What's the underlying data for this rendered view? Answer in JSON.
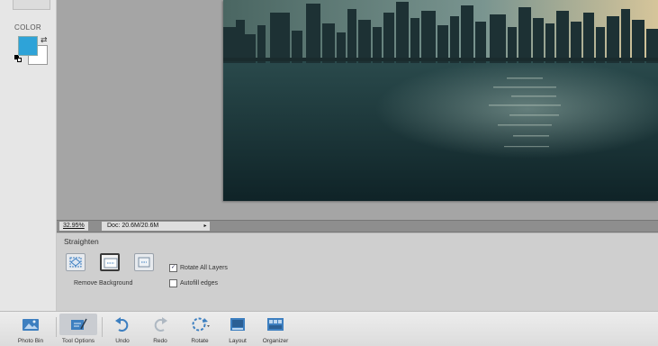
{
  "toolbox": {
    "color_label": "COLOR",
    "foreground_color": "#2ea3d8",
    "background_color": "#ffffff"
  },
  "status": {
    "zoom": "32.95%",
    "doc_size": "Doc: 20.6M/20.6M",
    "arrow": "▸"
  },
  "tool_options": {
    "title": "Straighten",
    "modes": [
      {
        "icon": "crop-to-original-size-icon",
        "selected": false
      },
      {
        "icon": "remove-background-icon",
        "selected": true
      },
      {
        "icon": "crop-to-remove-background-icon",
        "selected": false
      }
    ],
    "mode_caption": "Remove Background",
    "rotate_all_layers": {
      "label": "Rotate All Layers",
      "checked": true
    },
    "autofill_edges": {
      "label": "Autofill edges",
      "checked": false
    }
  },
  "taskbar": {
    "items": [
      {
        "label": "Photo Bin",
        "icon": "photo-bin-icon"
      },
      {
        "label": "Tool Options",
        "icon": "tool-options-icon",
        "active": true
      },
      {
        "label": "Undo",
        "icon": "undo-icon"
      },
      {
        "label": "Redo",
        "icon": "redo-icon"
      },
      {
        "label": "Rotate",
        "icon": "rotate-icon"
      },
      {
        "label": "Layout",
        "icon": "layout-icon"
      },
      {
        "label": "Organizer",
        "icon": "organizer-icon"
      }
    ]
  },
  "colors": {
    "accent_blue": "#3d7fc0",
    "workspace_gray": "#a5a5a5"
  }
}
